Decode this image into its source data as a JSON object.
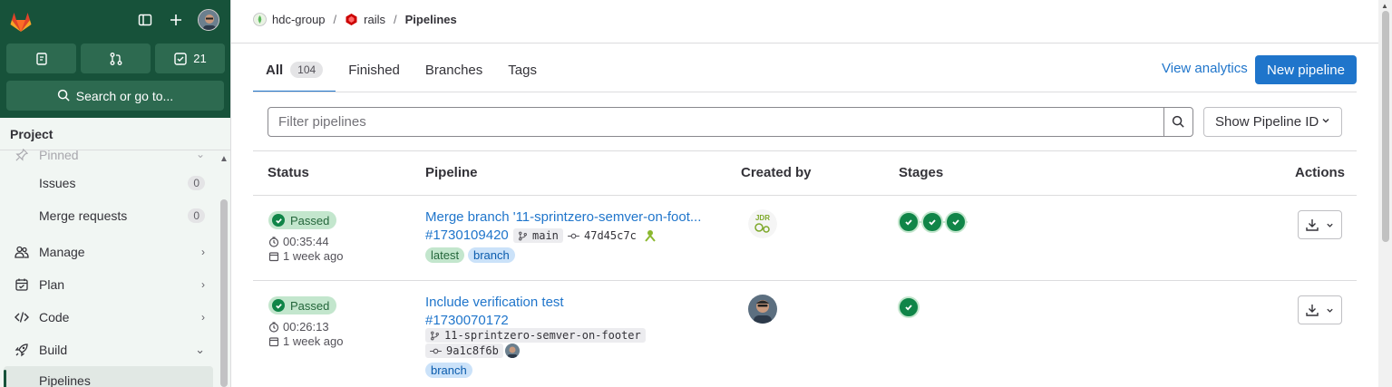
{
  "sidebar": {
    "todo_count": "21",
    "search_label": "Search or go to...",
    "section_title": "Project",
    "items": [
      {
        "label": "Pinned",
        "icon": "pin-icon"
      },
      {
        "label": "Issues",
        "count": "0"
      },
      {
        "label": "Merge requests",
        "count": "0"
      },
      {
        "label": "Manage",
        "icon": "users-icon"
      },
      {
        "label": "Plan",
        "icon": "calendar-icon"
      },
      {
        "label": "Code",
        "icon": "code-icon"
      },
      {
        "label": "Build",
        "icon": "rocket-icon"
      },
      {
        "label": "Pipelines"
      }
    ]
  },
  "breadcrumb": {
    "group": "hdc-group",
    "project": "rails",
    "current": "Pipelines"
  },
  "tabs": [
    {
      "label": "All",
      "count": "104"
    },
    {
      "label": "Finished"
    },
    {
      "label": "Branches"
    },
    {
      "label": "Tags"
    }
  ],
  "actions": {
    "view_analytics": "View analytics",
    "new_pipeline": "New pipeline"
  },
  "filter": {
    "placeholder": "Filter pipelines",
    "show_id": "Show Pipeline ID"
  },
  "table": {
    "headers": [
      "Status",
      "Pipeline",
      "Created by",
      "Stages",
      "Actions"
    ],
    "rows": [
      {
        "status": "Passed",
        "duration": "00:35:44",
        "finished": "1 week ago",
        "title": "Merge branch '11-sprintzero-semver-on-foot...",
        "id": "#1730109420",
        "branch": "main",
        "commit": "47d45c7c",
        "tags": [
          "latest",
          "branch"
        ],
        "stages": 3
      },
      {
        "status": "Passed",
        "duration": "00:26:13",
        "finished": "1 week ago",
        "title": "Include verification test",
        "id": "#1730070172",
        "branch": "11-sprintzero-semver-on-footer",
        "commit": "9a1c8f6b",
        "tags": [
          "branch"
        ],
        "stages": 1
      }
    ]
  },
  "colors": {
    "sidebar_top": "#17523a",
    "link": "#1f75cb",
    "success": "#108548"
  }
}
